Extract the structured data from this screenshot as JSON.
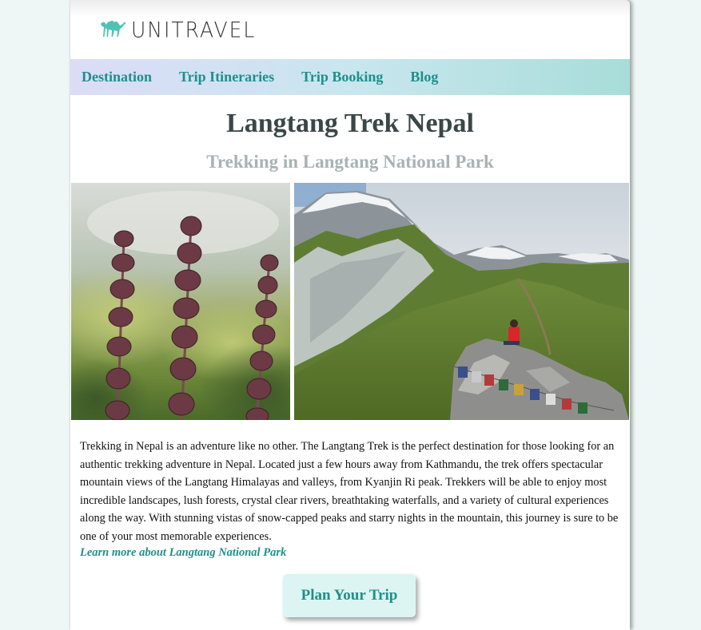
{
  "brand": {
    "name": "UNITRAVEL",
    "logo_icon": "camel-icon",
    "accent": "#1f8f8c"
  },
  "nav": {
    "items": [
      {
        "label": "Destination"
      },
      {
        "label": "Trip Itineraries"
      },
      {
        "label": "Trip Booking"
      },
      {
        "label": "Blog"
      }
    ]
  },
  "hero": {
    "title": "Langtang Trek Nepal",
    "subtitle": "Trekking in Langtang National Park"
  },
  "content": {
    "paragraph": "Trekking in Nepal is an adventure like no other. The Langtang Trek is the perfect destination for those looking for an authentic trekking adventure in Nepal. Located just a few hours away from Kathmandu, the trek offers spectacular mountain views of the Langtang Himalayas and valleys, from Kyanjin Ri peak. Trekkers will be able to enjoy most incredible landscapes, lush forests, crystal clear rivers, breathtaking waterfalls, and a variety of cultural experiences along the way. With stunning vistas of snow-capped peaks and starry nights in the mountain, this journey is sure to be one of your most memorable experiences.",
    "link_label": "Learn more about Langtang National Park"
  },
  "cta": {
    "label": "Plan Your Trip"
  }
}
